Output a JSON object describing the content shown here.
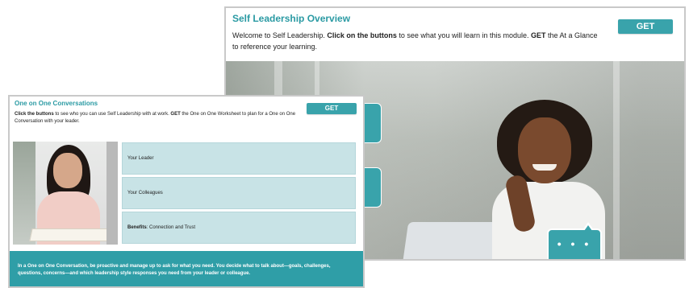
{
  "back_slide": {
    "title": "Self Leadership Overview",
    "intro_part1": "Welcome to Self Leadership. ",
    "intro_bold1": "Click on the buttons",
    "intro_part2": " to see what you will learn in this module. ",
    "intro_bold2": "GET",
    "intro_part3": " the At a Glance to reference your learning.",
    "get_button": "GET",
    "speech_bubble": "• • •"
  },
  "front_slide": {
    "title": "One on One Conversations",
    "intro_bold1": "Click the buttons",
    "intro_part1": " to see who you can use Self Leadership with at work. ",
    "intro_bold2": "GET",
    "intro_part2": " the One on One Worksheet to plan for a One on One Conversation with your leader.",
    "get_button": "GET",
    "options": [
      {
        "label": "Your Leader"
      },
      {
        "label": "Your Colleagues"
      },
      {
        "label_bold": "Benefits",
        "label_rest": ": Connection and Trust"
      }
    ],
    "banner_text": "In a One on One Conversation, be proactive and manage up to ask for what you need. You decide what to talk about—goals, challenges, questions, concerns—and which leadership style responses you need from your leader or colleague."
  },
  "colors": {
    "teal_accent": "#2a9aa3",
    "option_bg": "#c8e3e6",
    "banner_bg": "#2f9ea7"
  }
}
